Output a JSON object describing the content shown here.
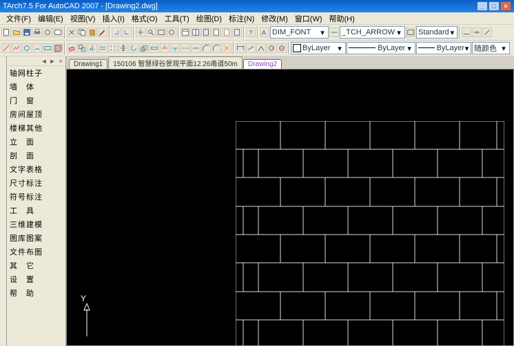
{
  "title": "TArch7.5 For AutoCAD 2007 - [Drawing2.dwg]",
  "menu": [
    "文件(F)",
    "编辑(E)",
    "视图(V)",
    "插入(I)",
    "格式(O)",
    "工具(T)",
    "绘图(D)",
    "标注(N)",
    "修改(M)",
    "窗口(W)",
    "帮助(H)"
  ],
  "winbtns": [
    "_",
    "□",
    "×"
  ],
  "props": {
    "textStyle": "DIM_FONT",
    "dimStyle": "_TCH_ARROW",
    "tableStyle": "Standard",
    "layerColor": "ByLayer",
    "lineweight": "ByLayer",
    "plotStyle": "随颜色",
    "linetype": "ByLayer"
  },
  "sidepanel": [
    "轴网柱子",
    "墙　体",
    "门　窗",
    "房间屋顶",
    "楼梯其他",
    "立　面",
    "剖　面",
    "文字表格",
    "尺寸标注",
    "符号标注",
    "工　具",
    "三维建模",
    "图库图案",
    "文件布图",
    "其　它",
    "设　置",
    "帮　助"
  ],
  "tabs": [
    {
      "label": "Drawing1",
      "active": false
    },
    {
      "label": "150106 智慧绿谷景观平面12.26甬道50m",
      "active": false
    },
    {
      "label": "Drawing2",
      "active": true
    }
  ],
  "chart_data": {
    "type": "diagram",
    "description": "brick-hatch-pattern",
    "rows": 8,
    "cols_full": 6,
    "offset_pattern": "running-bond",
    "brick_width": 65,
    "brick_height": 41
  },
  "ucs": {
    "y": "Y"
  }
}
